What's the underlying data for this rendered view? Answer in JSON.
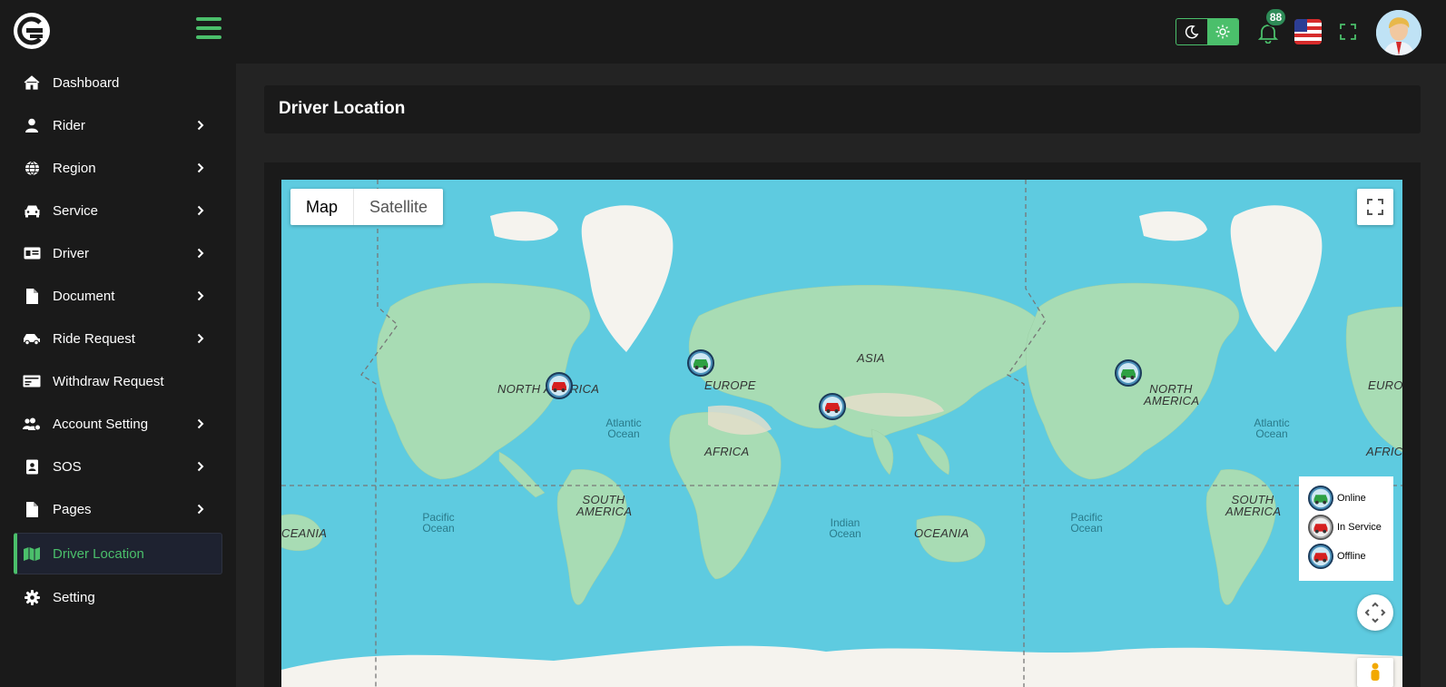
{
  "header": {
    "notification_count": "88",
    "icons": [
      "logo-icon",
      "menu-icon",
      "moon-icon",
      "sun-icon",
      "bell-icon",
      "us-flag-icon",
      "fullscreen-icon",
      "avatar"
    ]
  },
  "sidebar": {
    "items": [
      {
        "label": "Dashboard",
        "icon": "home-icon",
        "has_submenu": false
      },
      {
        "label": "Rider",
        "icon": "user-icon",
        "has_submenu": true
      },
      {
        "label": "Region",
        "icon": "globe-icon",
        "has_submenu": true
      },
      {
        "label": "Service",
        "icon": "car-icon",
        "has_submenu": true
      },
      {
        "label": "Driver",
        "icon": "id-card-icon",
        "has_submenu": true
      },
      {
        "label": "Document",
        "icon": "file-icon",
        "has_submenu": true
      },
      {
        "label": "Ride Request",
        "icon": "car-side-icon",
        "has_submenu": true
      },
      {
        "label": "Withdraw Request",
        "icon": "money-check-icon",
        "has_submenu": false
      },
      {
        "label": "Account Setting",
        "icon": "users-cog-icon",
        "has_submenu": true
      },
      {
        "label": "SOS",
        "icon": "address-book-icon",
        "has_submenu": true
      },
      {
        "label": "Pages",
        "icon": "file-icon",
        "has_submenu": true
      },
      {
        "label": "Driver Location",
        "icon": "map-icon",
        "has_submenu": false,
        "active": true
      },
      {
        "label": "Setting",
        "icon": "gear-icon",
        "has_submenu": false
      }
    ]
  },
  "page": {
    "title": "Driver Location"
  },
  "map": {
    "type_buttons": {
      "map": "Map",
      "satellite": "Satellite"
    },
    "selected_type": "Map",
    "labels": {
      "north_america": "NORTH AMERICA",
      "europe": "EUROPE",
      "asia": "ASIA",
      "africa": "AFRICA",
      "south_america": "SOUTH AMERICA",
      "oceania": "OCEANIA",
      "oceania_partial": "CEANIA",
      "europe_partial": "EURO",
      "africa_partial": "AFRIC",
      "atlantic_ocean": "Atlantic Ocean",
      "pacific_ocean": "Pacific Ocean",
      "indian_ocean": "Indian Ocean"
    },
    "legend": {
      "online": "Online",
      "in_service": "In Service",
      "offline": "Offline"
    },
    "colors": {
      "online": "#2ea043",
      "in_service": "#d62020",
      "offline": "#d62020",
      "ocean": "#5ecbe0",
      "land": "#a8dcb4"
    }
  }
}
